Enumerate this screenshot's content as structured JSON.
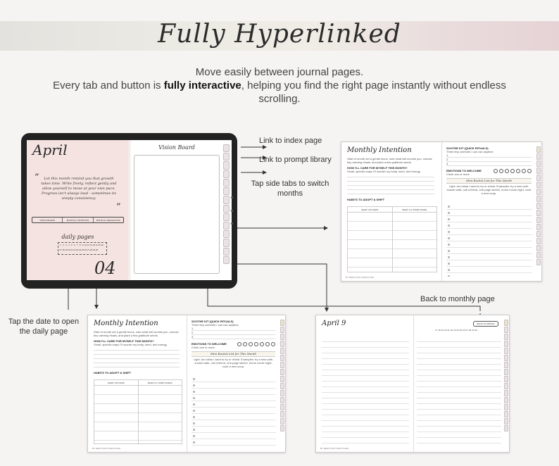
{
  "banner": {
    "title": "Fully Hyperlinked"
  },
  "intro": {
    "line1": "Move easily between journal pages.",
    "line2_pre": "Every tab and button is ",
    "line2_bold": "fully interactive",
    "line2_post": ", helping you find the right page instantly without endless scrolling."
  },
  "callouts": {
    "index": "Link to index page",
    "prompt": "Link to prompt library",
    "side_tabs": "Tap side tabs to switch months",
    "tap_date": "Tap the date to open the daily page",
    "back_monthly": "Back to monthly page"
  },
  "tablet": {
    "month": "April",
    "quote": "Let this month remind you that growth takes time. Write freely, reflect gently and allow yourself to move at your own pace. Progress isn't always loud - sometimes its simply consistency.",
    "open_quote": "”",
    "close_quote": "”",
    "tabs": [
      "VISION BOARD",
      "MONTHLY INTENTION",
      "MONTHLY REFLECTION"
    ],
    "daily_title": "daily pages",
    "days": [
      "1",
      "2",
      "3",
      "4",
      "5",
      "6",
      "7",
      "8",
      "9",
      "10",
      "11",
      "12",
      "13",
      "14",
      "15",
      "16",
      "17",
      "18",
      "19",
      "20",
      "21",
      "22",
      "23",
      "24",
      "25",
      "26",
      "27",
      "28",
      "29",
      "30"
    ],
    "month_number": "04",
    "vision_title": "Vision Board"
  },
  "intention": {
    "title": "Monthly Intention",
    "intro": "Start of month set a gentle focus, note what will nourish you, choose tiny calming rituals, and plant a few gratitude seeds.",
    "care_heading": "HOW I'LL CARE FOR MYSELF THIS MONTH?",
    "care_sub": "Small, specific ways I'll nourish my body, mind, and energy.",
    "habits_heading": "HABITS TO ADOPT & SHIFT",
    "col_now": "WHAT I DO NOW",
    "col_start": "WHAT I'LL START DOING",
    "soothe_heading": "SOOTHE KIT (QUICK RITUALS)",
    "soothe_sub": "Three tiny comforts I can use anytime",
    "soothe_items": [
      "1.",
      "2.",
      "3."
    ],
    "emotions_heading": "EMOTIONS TO WELCOME",
    "emotions_sub": "Circle one or more",
    "bucket_title": "Mini Bucket List for This Month",
    "bucket_sub": "Light, fun ideas I want to try or revisit. Examples: try a new cafe, sunset walk, call a friend, one-page sketch, home movie night, cook a new soup.",
    "footer": "BY NEST FOR YOUR PLANS"
  },
  "daily": {
    "title": "April 9",
    "back_button": "BACK TO MONTH",
    "days": [
      "1",
      "2",
      "3",
      "4",
      "5",
      "6",
      "7",
      "8",
      "9",
      "10",
      "11",
      "12",
      "13",
      "14",
      "15",
      "16",
      "17",
      "18",
      "19",
      "20",
      "21",
      "22",
      "23",
      "24",
      "25",
      "26",
      "27",
      "28",
      "29",
      "30"
    ],
    "footer": "BY NEST FOR YOUR PLANS"
  }
}
